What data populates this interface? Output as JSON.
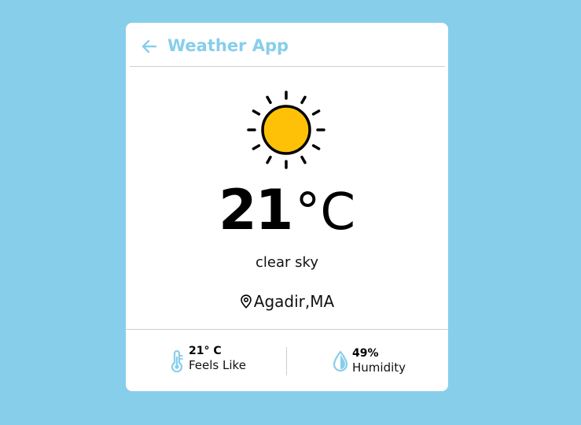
{
  "header": {
    "title": "Weather App",
    "back_icon": "arrow-left-icon"
  },
  "weather": {
    "icon": "sun-icon",
    "temperature": "21",
    "unit": "°C",
    "description": "clear sky",
    "location": "Agadir,MA",
    "location_icon": "map-pin-icon"
  },
  "details": {
    "feels_like": {
      "value": "21° C",
      "label": "Feels Like",
      "icon": "thermometer-icon"
    },
    "humidity": {
      "value": "49%",
      "label": "Humidity",
      "icon": "droplet-icon"
    }
  },
  "colors": {
    "background": "#87ceeb",
    "accent": "#87ceeb",
    "sun_fill": "#ffc107",
    "card": "#ffffff"
  }
}
